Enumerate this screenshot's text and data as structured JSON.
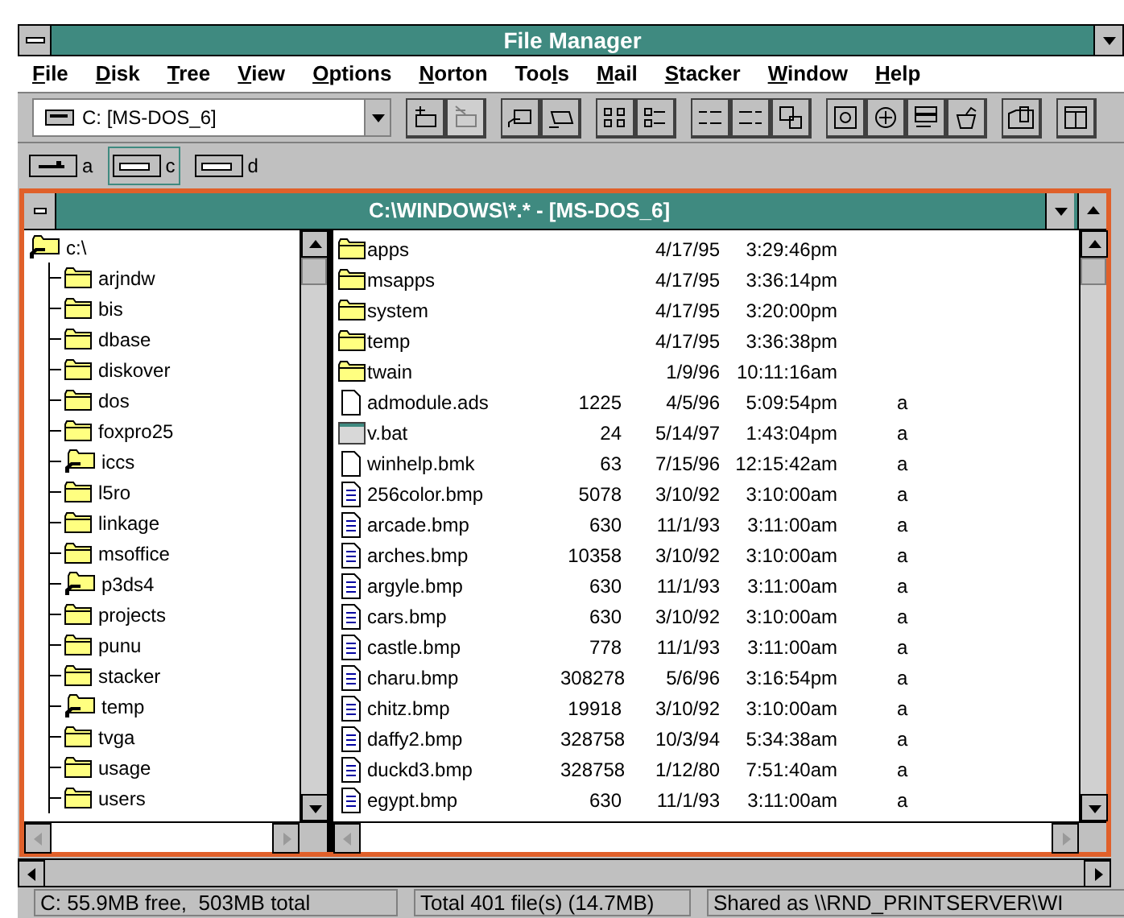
{
  "window": {
    "title": "File Manager"
  },
  "menu": [
    {
      "key": "F",
      "post": "ile"
    },
    {
      "key": "D",
      "post": "isk"
    },
    {
      "key": "T",
      "post": "ree"
    },
    {
      "key": "V",
      "post": "iew"
    },
    {
      "key": "O",
      "post": "ptions"
    },
    {
      "key": "N",
      "post": "orton"
    },
    {
      "pre": "Too",
      "key": "l",
      "post": "s"
    },
    {
      "key": "M",
      "post": "ail"
    },
    {
      "key": "S",
      "post": "tacker"
    },
    {
      "key": "W",
      "post": "indow"
    },
    {
      "key": "H",
      "post": "elp"
    }
  ],
  "toolbar": {
    "drive_select": {
      "value": "C: [MS-DOS_6]"
    },
    "groups": [
      [
        {
          "kind": "connect",
          "disabled": false
        },
        {
          "kind": "disconnect",
          "disabled": true
        }
      ],
      [
        {
          "kind": "share",
          "disabled": false
        },
        {
          "kind": "unshare",
          "disabled": false
        }
      ],
      [
        {
          "kind": "icons",
          "disabled": false
        },
        {
          "kind": "details",
          "disabled": false
        }
      ],
      [
        {
          "kind": "sortname",
          "disabled": false
        },
        {
          "kind": "sortext",
          "disabled": false
        },
        {
          "kind": "find",
          "disabled": false
        }
      ],
      [
        {
          "kind": "safe",
          "disabled": false
        },
        {
          "kind": "add",
          "disabled": false
        },
        {
          "kind": "list",
          "disabled": false
        },
        {
          "kind": "undo",
          "disabled": false
        }
      ],
      [
        {
          "kind": "view",
          "disabled": false
        }
      ],
      [
        {
          "kind": "split",
          "disabled": false
        }
      ]
    ]
  },
  "drives": [
    {
      "label": "a",
      "kind": "floppy",
      "selected": false
    },
    {
      "label": "c",
      "kind": "hard",
      "selected": true
    },
    {
      "label": "d",
      "kind": "hard",
      "selected": false
    }
  ],
  "directory_window": {
    "title": "C:\\WINDOWS\\*.* - [MS-DOS_6]",
    "tree": {
      "name": "c:\\",
      "kind": "shared",
      "children": [
        {
          "name": "arjndw",
          "kind": "folder"
        },
        {
          "name": "bis",
          "kind": "folder"
        },
        {
          "name": "dbase",
          "kind": "folder"
        },
        {
          "name": "diskover",
          "kind": "folder"
        },
        {
          "name": "dos",
          "kind": "folder"
        },
        {
          "name": "foxpro25",
          "kind": "folder"
        },
        {
          "name": "iccs",
          "kind": "shared"
        },
        {
          "name": "l5ro",
          "kind": "folder"
        },
        {
          "name": "linkage",
          "kind": "folder"
        },
        {
          "name": "msoffice",
          "kind": "folder"
        },
        {
          "name": "p3ds4",
          "kind": "shared"
        },
        {
          "name": "projects",
          "kind": "folder"
        },
        {
          "name": "punu",
          "kind": "folder"
        },
        {
          "name": "stacker",
          "kind": "folder"
        },
        {
          "name": "temp",
          "kind": "shared"
        },
        {
          "name": "tvga",
          "kind": "folder"
        },
        {
          "name": "usage",
          "kind": "folder"
        },
        {
          "name": "users",
          "kind": "folder"
        }
      ]
    },
    "files": [
      {
        "name": "apps",
        "kind": "folder",
        "date": "4/17/95",
        "time": "3:29:46pm"
      },
      {
        "name": "msapps",
        "kind": "folder",
        "date": "4/17/95",
        "time": "3:36:14pm"
      },
      {
        "name": "system",
        "kind": "folder",
        "date": "4/17/95",
        "time": "3:20:00pm"
      },
      {
        "name": "temp",
        "kind": "folder",
        "date": "4/17/95",
        "time": "3:36:38pm"
      },
      {
        "name": "twain",
        "kind": "folder",
        "date": "1/9/96",
        "time": "10:11:16am"
      },
      {
        "name": "admodule.ads",
        "kind": "file",
        "size": "1225",
        "date": "4/5/96",
        "time": "5:09:54pm",
        "attributes": "a"
      },
      {
        "name": "v.bat",
        "kind": "program",
        "size": "24",
        "date": "5/14/97",
        "time": "1:43:04pm",
        "attributes": "a"
      },
      {
        "name": "winhelp.bmk",
        "kind": "file",
        "size": "63",
        "date": "7/15/96",
        "time": "12:15:42am",
        "attributes": "a"
      },
      {
        "name": "256color.bmp",
        "kind": "document",
        "size": "5078",
        "date": "3/10/92",
        "time": "3:10:00am",
        "attributes": "a"
      },
      {
        "name": "arcade.bmp",
        "kind": "document",
        "size": "630",
        "date": "11/1/93",
        "time": "3:11:00am",
        "attributes": "a"
      },
      {
        "name": "arches.bmp",
        "kind": "document",
        "size": "10358",
        "date": "3/10/92",
        "time": "3:10:00am",
        "attributes": "a"
      },
      {
        "name": "argyle.bmp",
        "kind": "document",
        "size": "630",
        "date": "11/1/93",
        "time": "3:11:00am",
        "attributes": "a"
      },
      {
        "name": "cars.bmp",
        "kind": "document",
        "size": "630",
        "date": "3/10/92",
        "time": "3:10:00am",
        "attributes": "a"
      },
      {
        "name": "castle.bmp",
        "kind": "document",
        "size": "778",
        "date": "11/1/93",
        "time": "3:11:00am",
        "attributes": "a"
      },
      {
        "name": "charu.bmp",
        "kind": "document",
        "size": "308278",
        "date": "5/6/96",
        "time": "3:16:54pm",
        "attributes": "a"
      },
      {
        "name": "chitz.bmp",
        "kind": "document",
        "size": "19918",
        "date": "3/10/92",
        "time": "3:10:00am",
        "attributes": "a"
      },
      {
        "name": "daffy2.bmp",
        "kind": "document",
        "size": "328758",
        "date": "10/3/94",
        "time": "5:34:38am",
        "attributes": "a"
      },
      {
        "name": "duckd3.bmp",
        "kind": "document",
        "size": "328758",
        "date": "1/12/80",
        "time": "7:51:40am",
        "attributes": "a"
      },
      {
        "name": "egypt.bmp",
        "kind": "document",
        "size": "630",
        "date": "11/1/93",
        "time": "3:11:00am",
        "attributes": "a"
      }
    ]
  },
  "status_bar": [
    "C: 55.9MB free,  503MB total",
    "Total 401 file(s) (14.7MB)",
    "Shared as \\\\RND_PRINTSERVER\\WI"
  ]
}
